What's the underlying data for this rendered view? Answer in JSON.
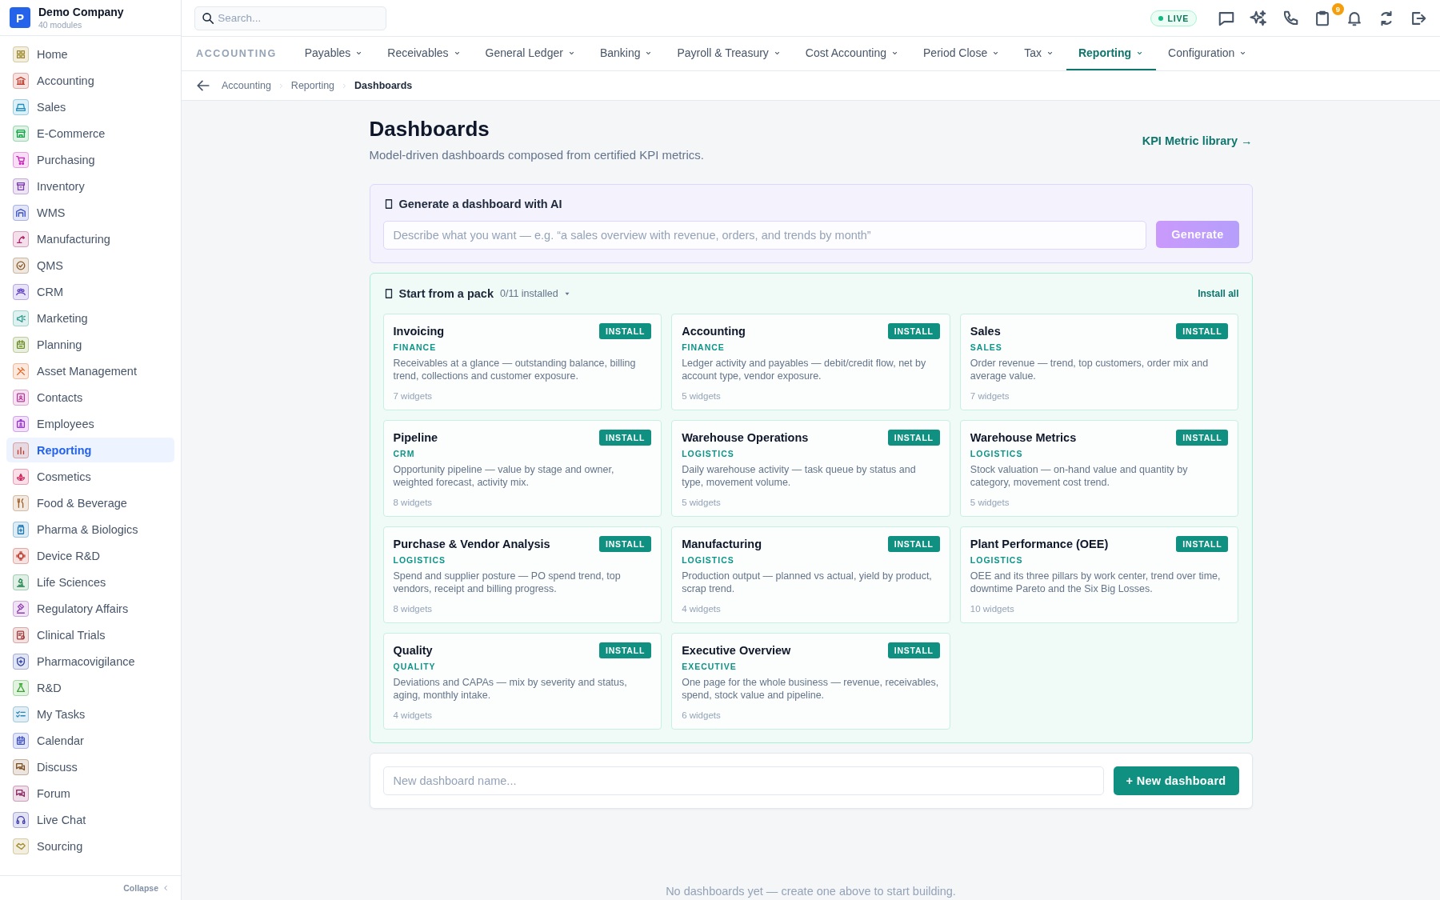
{
  "company": {
    "logo": "P",
    "name": "Demo Company",
    "subtitle": "40 modules"
  },
  "sidebar": {
    "items": [
      {
        "label": "Home",
        "color": "#a08a2a",
        "selected": false
      },
      {
        "label": "Accounting",
        "color": "#c0392b",
        "selected": false
      },
      {
        "label": "Sales",
        "color": "#1d8fc1",
        "selected": false
      },
      {
        "label": "E-Commerce",
        "color": "#16a34a",
        "selected": false
      },
      {
        "label": "Purchasing",
        "color": "#c822b8",
        "selected": false
      },
      {
        "label": "Inventory",
        "color": "#7e3fb0",
        "selected": false
      },
      {
        "label": "WMS",
        "color": "#3b4fc4",
        "selected": false
      },
      {
        "label": "Manufacturing",
        "color": "#b0206a",
        "selected": false
      },
      {
        "label": "QMS",
        "color": "#8a5a2b",
        "selected": false
      },
      {
        "label": "CRM",
        "color": "#5b3cc4",
        "selected": false
      },
      {
        "label": "Marketing",
        "color": "#2a9d8f",
        "selected": false
      },
      {
        "label": "Planning",
        "color": "#6b8e23",
        "selected": false
      },
      {
        "label": "Asset Management",
        "color": "#e0621c",
        "selected": false
      },
      {
        "label": "Contacts",
        "color": "#b83a9a",
        "selected": false
      },
      {
        "label": "Employees",
        "color": "#9b30d0",
        "selected": false
      },
      {
        "label": "Reporting",
        "color": "#c0392b",
        "selected": true
      },
      {
        "label": "Cosmetics",
        "color": "#d0245c",
        "selected": false
      },
      {
        "label": "Food & Beverage",
        "color": "#a0622a",
        "selected": false
      },
      {
        "label": "Pharma & Biologics",
        "color": "#1f78b4",
        "selected": false
      },
      {
        "label": "Device R&D",
        "color": "#c0392b",
        "selected": false
      },
      {
        "label": "Life Sciences",
        "color": "#2e8b57",
        "selected": false
      },
      {
        "label": "Regulatory Affairs",
        "color": "#8e3cb0",
        "selected": false
      },
      {
        "label": "Clinical Trials",
        "color": "#a33a3a",
        "selected": false
      },
      {
        "label": "Pharmacovigilance",
        "color": "#3346a8",
        "selected": false
      },
      {
        "label": "R&D",
        "color": "#3aa530",
        "selected": false
      },
      {
        "label": "My Tasks",
        "color": "#2a86b8",
        "selected": false
      },
      {
        "label": "Calendar",
        "color": "#3b4fc4",
        "selected": false
      },
      {
        "label": "Discuss",
        "color": "#7a4a1a",
        "selected": false
      },
      {
        "label": "Forum",
        "color": "#8a2060",
        "selected": false
      },
      {
        "label": "Live Chat",
        "color": "#3a3aa8",
        "selected": false
      },
      {
        "label": "Sourcing",
        "color": "#a08a2a",
        "selected": false
      }
    ],
    "collapse": "Collapse"
  },
  "search": {
    "placeholder": "Search..."
  },
  "status": {
    "live": "LIVE"
  },
  "notifications_badge": "9",
  "module_tabs": {
    "module": "ACCOUNTING",
    "tabs": [
      {
        "label": "Payables",
        "selected": false
      },
      {
        "label": "Receivables",
        "selected": false
      },
      {
        "label": "General Ledger",
        "selected": false
      },
      {
        "label": "Banking",
        "selected": false
      },
      {
        "label": "Payroll & Treasury",
        "selected": false
      },
      {
        "label": "Cost Accounting",
        "selected": false
      },
      {
        "label": "Period Close",
        "selected": false
      },
      {
        "label": "Tax",
        "selected": false
      },
      {
        "label": "Reporting",
        "selected": true
      },
      {
        "label": "Configuration",
        "selected": false
      }
    ]
  },
  "breadcrumb": [
    "Accounting",
    "Reporting",
    "Dashboards"
  ],
  "page": {
    "title": "Dashboards",
    "subtitle": "Model-driven dashboards composed from certified KPI metrics.",
    "library_link": "KPI Metric library →"
  },
  "ai_panel": {
    "title": "Generate a dashboard with AI",
    "placeholder": "Describe what you want — e.g. “a sales overview with revenue, orders, and trends by month”",
    "button": "Generate",
    "disabled": true
  },
  "packs": {
    "title": "Start from a pack",
    "installed": "0/11 installed",
    "install_all": "Install all",
    "items": [
      {
        "title": "Invoicing",
        "category": "FINANCE",
        "description": "Receivables at a glance — outstanding balance, billing trend, collections and customer exposure.",
        "widgets": "7 widgets",
        "button": "INSTALL"
      },
      {
        "title": "Accounting",
        "category": "FINANCE",
        "description": "Ledger activity and payables — debit/credit flow, net by account type, vendor exposure.",
        "widgets": "5 widgets",
        "button": "INSTALL"
      },
      {
        "title": "Sales",
        "category": "SALES",
        "description": "Order revenue — trend, top customers, order mix and average value.",
        "widgets": "7 widgets",
        "button": "INSTALL"
      },
      {
        "title": "Pipeline",
        "category": "CRM",
        "description": "Opportunity pipeline — value by stage and owner, weighted forecast, activity mix.",
        "widgets": "8 widgets",
        "button": "INSTALL"
      },
      {
        "title": "Warehouse Operations",
        "category": "LOGISTICS",
        "description": "Daily warehouse activity — task queue by status and type, movement volume.",
        "widgets": "5 widgets",
        "button": "INSTALL"
      },
      {
        "title": "Warehouse Metrics",
        "category": "LOGISTICS",
        "description": "Stock valuation — on-hand value and quantity by category, movement cost trend.",
        "widgets": "5 widgets",
        "button": "INSTALL"
      },
      {
        "title": "Purchase & Vendor Analysis",
        "category": "LOGISTICS",
        "description": "Spend and supplier posture — PO spend trend, top vendors, receipt and billing progress.",
        "widgets": "8 widgets",
        "button": "INSTALL"
      },
      {
        "title": "Manufacturing",
        "category": "LOGISTICS",
        "description": "Production output — planned vs actual, yield by product, scrap trend.",
        "widgets": "4 widgets",
        "button": "INSTALL"
      },
      {
        "title": "Plant Performance (OEE)",
        "category": "LOGISTICS",
        "description": "OEE and its three pillars by work center, trend over time, downtime Pareto and the Six Big Losses.",
        "widgets": "10 widgets",
        "button": "INSTALL"
      },
      {
        "title": "Quality",
        "category": "QUALITY",
        "description": "Deviations and CAPAs — mix by severity and status, aging, monthly intake.",
        "widgets": "4 widgets",
        "button": "INSTALL"
      },
      {
        "title": "Executive Overview",
        "category": "EXECUTIVE",
        "description": "One page for the whole business — revenue, receivables, spend, stock value and pipeline.",
        "widgets": "6 widgets",
        "button": "INSTALL"
      }
    ]
  },
  "new_dashboard": {
    "placeholder": "New dashboard name...",
    "button": "+ New dashboard"
  },
  "empty_message": "No dashboards yet — create one above to start building."
}
